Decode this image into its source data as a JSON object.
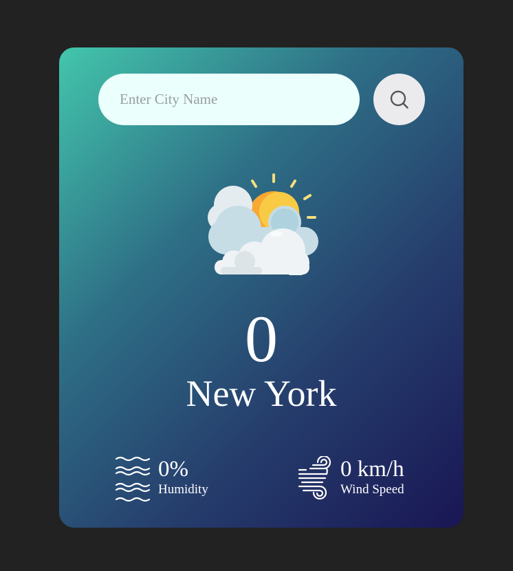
{
  "search": {
    "placeholder": "Enter City Name",
    "value": "",
    "button_icon": "search-icon"
  },
  "weather": {
    "icon": "sun-behind-clouds-icon",
    "temperature": "0",
    "city": "New York"
  },
  "details": {
    "humidity": {
      "icon": "humidity-waves-icon",
      "value": "0%",
      "label": "Humidity"
    },
    "wind": {
      "icon": "wind-icon",
      "value": "0 km/h",
      "label": "Wind Speed"
    }
  },
  "colors": {
    "page_background": "#222222",
    "gradient_start": "#43c6ac",
    "gradient_end": "#191654",
    "search_background": "#ebfffc",
    "button_background": "#ebebed"
  }
}
